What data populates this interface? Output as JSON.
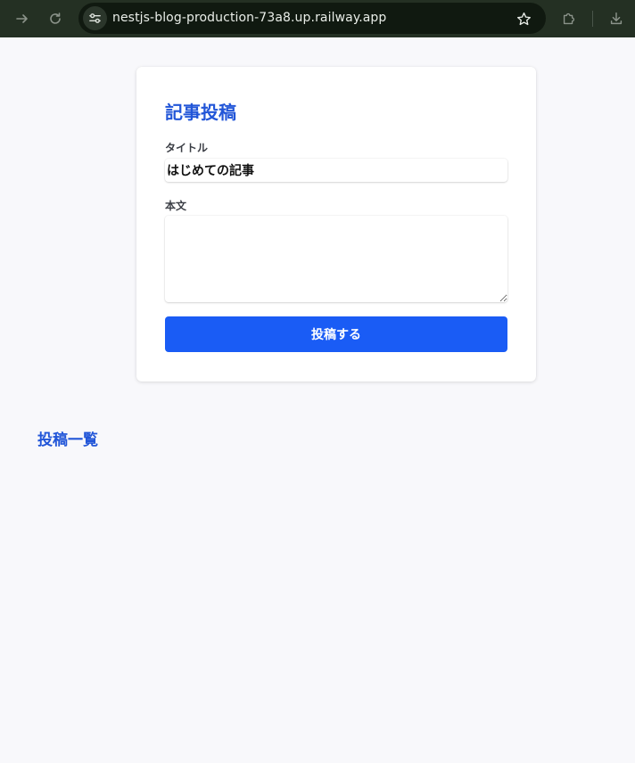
{
  "browser": {
    "url": "nestjs-blog-production-73a8.up.railway.app",
    "icons": {
      "forward": "arrow-right-icon",
      "reload": "reload-icon",
      "site_info": "tune-icon",
      "bookmark": "star-icon",
      "extensions": "puzzle-icon",
      "downloads": "download-icon"
    }
  },
  "post_form": {
    "title": "記事投稿",
    "title_label": "タイトル",
    "title_value": "はじめての記事",
    "body_label": "本文",
    "body_value": "",
    "submit_label": "投稿する"
  },
  "post_list": {
    "title": "投稿一覧"
  },
  "colors": {
    "accent": "#2256d8",
    "button": "#1a5cf5",
    "chrome": "#243023",
    "background": "#f8f8fb"
  }
}
